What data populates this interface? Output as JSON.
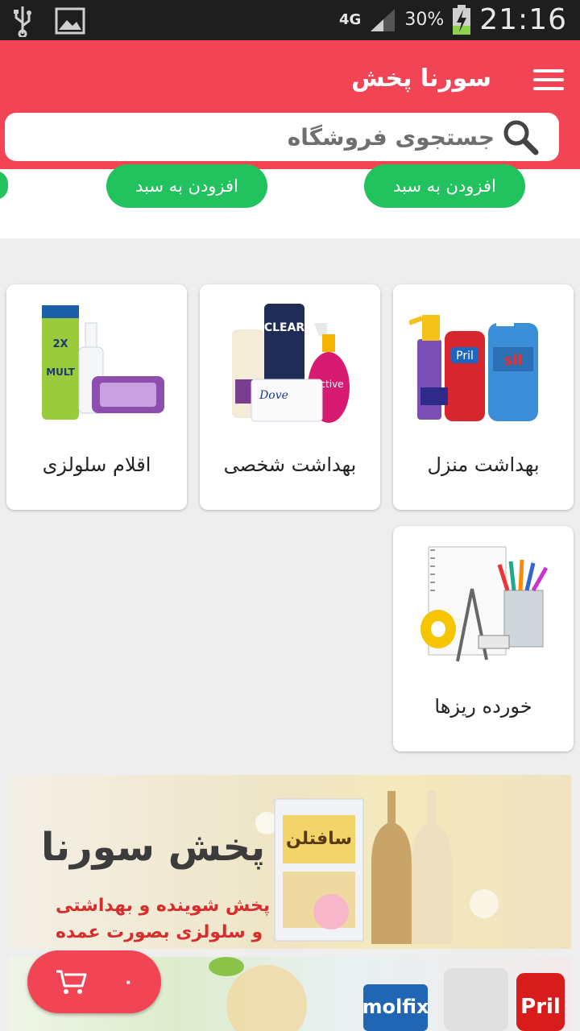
{
  "status_bar": {
    "network": "4G",
    "battery": "30%",
    "time": "21:16"
  },
  "app_bar": {
    "title": "سورنا پخش",
    "search_placeholder": "جستجوی فروشگاه"
  },
  "product_strip": {
    "add_to_cart_label": "افزودن به سبد"
  },
  "categories": [
    {
      "label": "بهداشت منزل",
      "icon": "household-cleaning-products"
    },
    {
      "label": "بهداشت شخصی",
      "icon": "personal-care-products"
    },
    {
      "label": "اقلام سلولزی",
      "icon": "cellulose-products"
    },
    {
      "label": "خورده ریزها",
      "icon": "stationery-items"
    }
  ],
  "banner": {
    "title": "پخش سورنا",
    "line1": "پخش شوینده و بهداشتی",
    "line2": "و سلولزی بصورت عمده",
    "product_brand": "سافتلن"
  },
  "banner2": {
    "brands": [
      "molfix",
      "Pril"
    ]
  },
  "cart": {
    "count": "۰"
  },
  "colors": {
    "primary": "#f14555",
    "accent_green": "#22c25e",
    "status_bar": "#1e1e1e"
  }
}
